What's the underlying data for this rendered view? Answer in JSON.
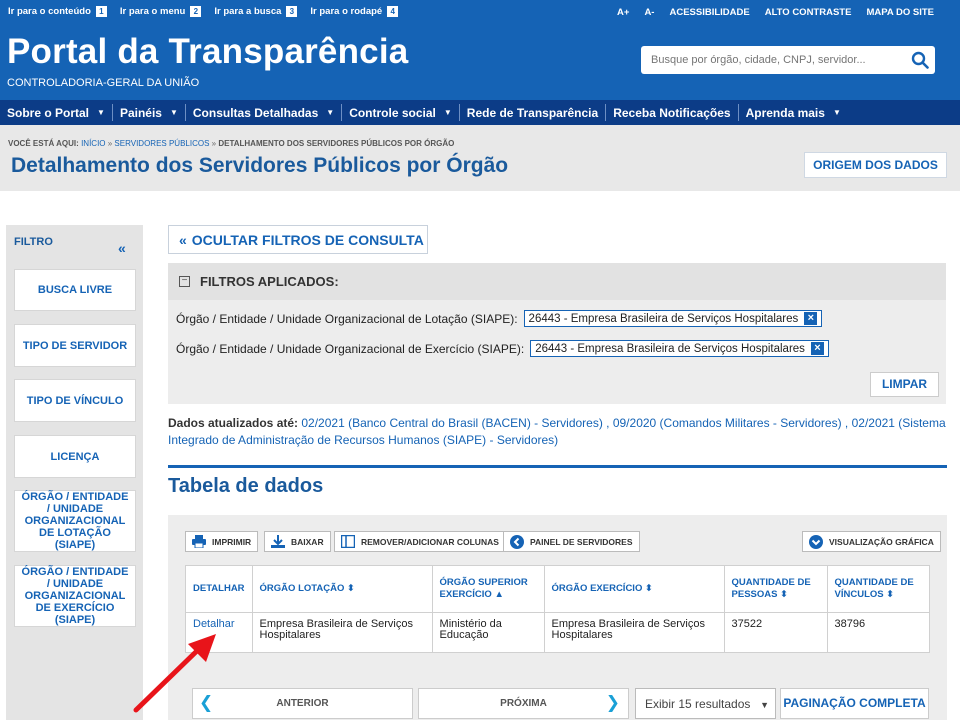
{
  "skip_links": [
    {
      "label": "Ir para o conteúdo",
      "key": "1"
    },
    {
      "label": "Ir para o menu",
      "key": "2"
    },
    {
      "label": "Ir para a busca",
      "key": "3"
    },
    {
      "label": "Ir para o rodapé",
      "key": "4"
    }
  ],
  "accessibility": [
    "A+",
    "A-",
    "ACESSIBILIDADE",
    "ALTO CONTRASTE",
    "MAPA DO SITE"
  ],
  "header": {
    "title": "Portal da Transparência",
    "subtitle": "CONTROLADORIA-GERAL DA UNIÃO",
    "search_placeholder": "Busque por órgão, cidade, CNPJ, servidor..."
  },
  "menu": [
    {
      "label": "Sobre o Portal",
      "dropdown": true
    },
    {
      "label": "Painéis",
      "dropdown": true
    },
    {
      "label": "Consultas Detalhadas",
      "dropdown": true
    },
    {
      "label": "Controle social",
      "dropdown": true
    },
    {
      "label": "Rede de Transparência",
      "dropdown": false
    },
    {
      "label": "Receba Notificações",
      "dropdown": false
    },
    {
      "label": "Aprenda mais",
      "dropdown": true
    }
  ],
  "breadcrumb": {
    "prefix": "VOCÊ ESTÁ AQUI:",
    "items": [
      "INÍCIO",
      "SERVIDORES PÚBLICOS",
      "DETALHAMENTO DOS SERVIDORES PÚBLICOS POR ÓRGÃO"
    ]
  },
  "page_title": "Detalhamento dos Servidores Públicos por Órgão",
  "origem_label": "ORIGEM DOS DADOS",
  "sidebar": {
    "title": "FILTRO",
    "filters": [
      "BUSCA LIVRE",
      "TIPO DE SERVIDOR",
      "TIPO DE VÍNCULO",
      "LICENÇA",
      "ÓRGÃO / ENTIDADE / UNIDADE ORGANIZACIONAL DE LOTAÇÃO (SIAPE)",
      "ÓRGÃO / ENTIDADE / UNIDADE ORGANIZACIONAL DE EXERCÍCIO (SIAPE)"
    ]
  },
  "hide_filters_label": "OCULTAR FILTROS DE CONSULTA",
  "applied": {
    "title": "FILTROS APLICADOS:",
    "rows": [
      {
        "label": "Órgão / Entidade / Unidade Organizacional de Lotação (SIAPE):",
        "value": "26443 - Empresa Brasileira de Serviços Hospitalares"
      },
      {
        "label": "Órgão / Entidade / Unidade Organizacional de Exercício (SIAPE):",
        "value": "26443 - Empresa Brasileira de Serviços Hospitalares"
      }
    ],
    "clear_label": "LIMPAR"
  },
  "updated": {
    "label": "Dados atualizados até:",
    "text": "02/2021 (Banco Central do Brasil (BACEN) - Servidores) , 09/2020 (Comandos Militares - Servidores) , 02/2021 (Sistema Integrado de Administração de Recursos Humanos (SIAPE) - Servidores)"
  },
  "table_title": "Tabela de dados",
  "toolbar": {
    "print": "IMPRIMIR",
    "download": "BAIXAR",
    "columns": "REMOVER/ADICIONAR COLUNAS",
    "panel": "PAINEL DE SERVIDORES",
    "chart_view": "VISUALIZAÇÃO GRÁFICA"
  },
  "table": {
    "headers": [
      "DETALHAR",
      "ÓRGÃO LOTAÇÃO",
      "ÓRGÃO SUPERIOR EXERCÍCIO",
      "ÓRGÃO EXERCÍCIO",
      "QUANTIDADE DE PESSOAS",
      "QUANTIDADE DE VÍNCULOS"
    ],
    "rows": [
      [
        "Detalhar",
        "Empresa Brasileira de Serviços Hospitalares",
        "Ministério da Educação",
        "Empresa Brasileira de Serviços Hospitalares",
        "37522",
        "38796"
      ]
    ]
  },
  "pagination": {
    "prev": "ANTERIOR",
    "next": "PRÓXIMA",
    "page_size": "Exibir 15 resultados",
    "full": "PAGINAÇÃO COMPLETA"
  },
  "colors": {
    "brand_blue": "#1563b5",
    "menu_navy": "#0c3c87",
    "annotation_red": "#e8141a"
  }
}
